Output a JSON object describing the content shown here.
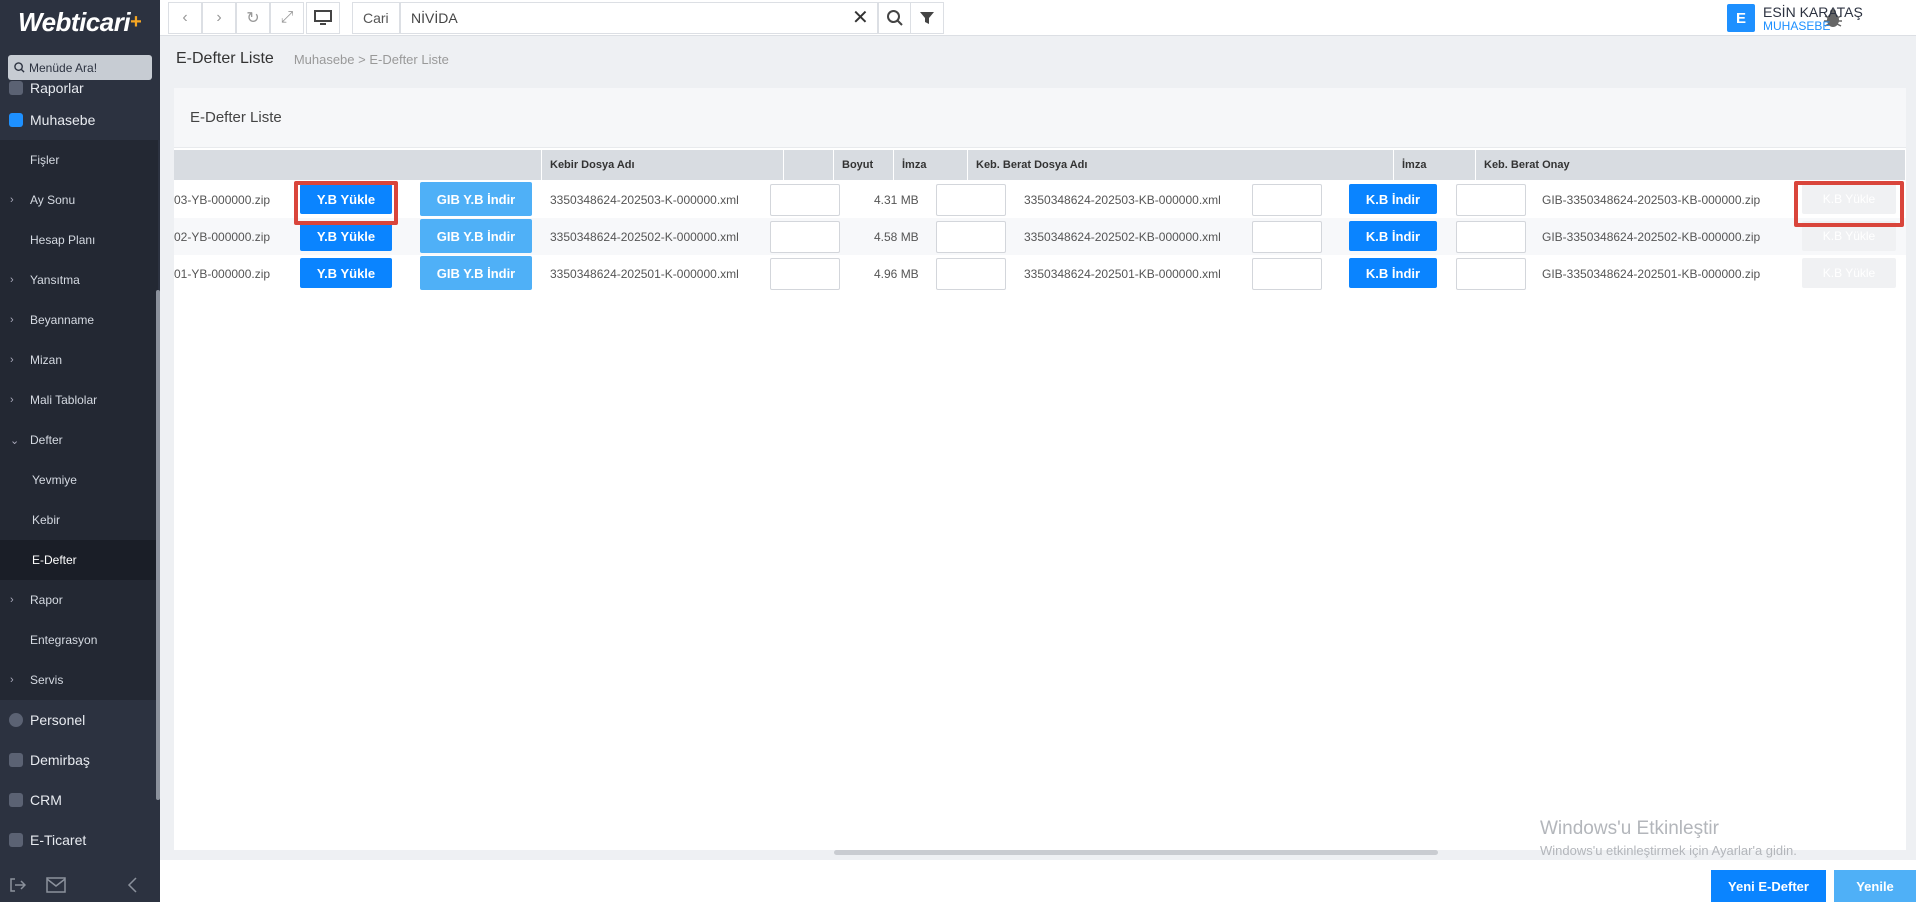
{
  "app": {
    "logo": "Webticari",
    "logo_plus": "+"
  },
  "sidebar": {
    "search_placeholder": "Menüde Ara!",
    "items": [
      {
        "label": "Raporlar"
      },
      {
        "label": "Muhasebe"
      },
      {
        "label": "Fişler"
      },
      {
        "label": "Ay Sonu"
      },
      {
        "label": "Hesap Planı"
      },
      {
        "label": "Yansıtma"
      },
      {
        "label": "Beyanname"
      },
      {
        "label": "Mizan"
      },
      {
        "label": "Mali Tablolar"
      },
      {
        "label": "Defter"
      },
      {
        "label": "Yevmiye"
      },
      {
        "label": "Kebir"
      },
      {
        "label": "E-Defter"
      },
      {
        "label": "Rapor"
      },
      {
        "label": "Entegrasyon"
      },
      {
        "label": "Servis"
      },
      {
        "label": "Personel"
      },
      {
        "label": "Demirbaş"
      },
      {
        "label": "CRM"
      },
      {
        "label": "E-Ticaret"
      }
    ]
  },
  "topbar": {
    "cari_label": "Cari",
    "cari_value": "NİVİDA",
    "user_initial": "E",
    "user_name": "ESİN KARATAŞ",
    "user_role": "MUHASEBE"
  },
  "breadcrumb": {
    "title": "E-Defter Liste",
    "path": "Muhasebe > E-Defter Liste"
  },
  "panel": {
    "title": "E-Defter Liste"
  },
  "table": {
    "headers": {
      "kebir_dosya": "Kebir Dosya Adı",
      "boyut": "Boyut",
      "imza1": "İmza",
      "keb_berat": "Keb. Berat Dosya Adı",
      "imza2": "İmza",
      "keb_berat_onay": "Keb. Berat Onay"
    },
    "rows": [
      {
        "yb_file": "03-YB-000000.zip",
        "yb_upload": "Y.B Yükle",
        "gib_download": "GIB Y.B İndir",
        "kebir_file": "3350348624-202503-K-000000.xml",
        "size": "4.31 MB",
        "kb_file": "3350348624-202503-KB-000000.xml",
        "kb_download": "K.B İndir",
        "kb_onay": "GIB-3350348624-202503-KB-000000.zip",
        "kb_upload": "K.B Yükle"
      },
      {
        "yb_file": "02-YB-000000.zip",
        "yb_upload": "Y.B Yükle",
        "gib_download": "GIB Y.B İndir",
        "kebir_file": "3350348624-202502-K-000000.xml",
        "size": "4.58 MB",
        "kb_file": "3350348624-202502-KB-000000.xml",
        "kb_download": "K.B İndir",
        "kb_onay": "GIB-3350348624-202502-KB-000000.zip",
        "kb_upload": "K.B Yükle"
      },
      {
        "yb_file": "01-YB-000000.zip",
        "yb_upload": "Y.B Yükle",
        "gib_download": "GIB Y.B İndir",
        "kebir_file": "3350348624-202501-K-000000.xml",
        "size": "4.96 MB",
        "kb_file": "3350348624-202501-KB-000000.xml",
        "kb_download": "K.B İndir",
        "kb_onay": "GIB-3350348624-202501-KB-000000.zip",
        "kb_upload": "K.B Yükle"
      }
    ]
  },
  "watermark": {
    "line1": "Windows'u Etkinleştir",
    "line2": "Windows'u etkinleştirmek için Ayarlar'a gidin."
  },
  "footer": {
    "new_label": "Yeni E-Defter",
    "refresh_label": "Yenile"
  },
  "colors": {
    "accent": "#0a84ff",
    "accent_light": "#4fb0f7",
    "sidebar_bg": "#2c3240",
    "highlight_box": "#d9453b"
  },
  "icons": [
    "search-icon",
    "back-icon",
    "forward-icon",
    "refresh-icon",
    "fullscreen-icon",
    "monitor-icon",
    "clear-icon",
    "filter-icon",
    "bug-icon",
    "apps-grid-icon",
    "logout-icon",
    "mail-icon",
    "collapse-icon"
  ]
}
